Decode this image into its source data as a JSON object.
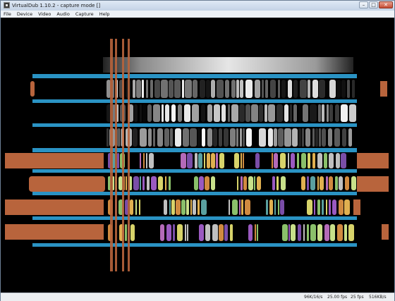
{
  "window": {
    "title": "VirtualDub 1.10.2 - capture mode []"
  },
  "menu": {
    "file": "File",
    "device": "Device",
    "video": "Video",
    "audio": "Audio",
    "capture": "Capture",
    "help": "Help"
  },
  "controls": {
    "minimize": "–",
    "maximize": "□",
    "close": "✕"
  },
  "status": {
    "audio_rate": "96K/16/s",
    "fps_target": "25.00 fps",
    "fps_actual": "25 fps",
    "data_rate": "516KB/s"
  },
  "icons": [
    "app-icon",
    "minimize-icon",
    "maximize-icon",
    "close-icon"
  ],
  "colors": {
    "stripe_blue": "#2a93c4",
    "stripe_orange": "#b8643c",
    "video_bg": "#000000"
  }
}
